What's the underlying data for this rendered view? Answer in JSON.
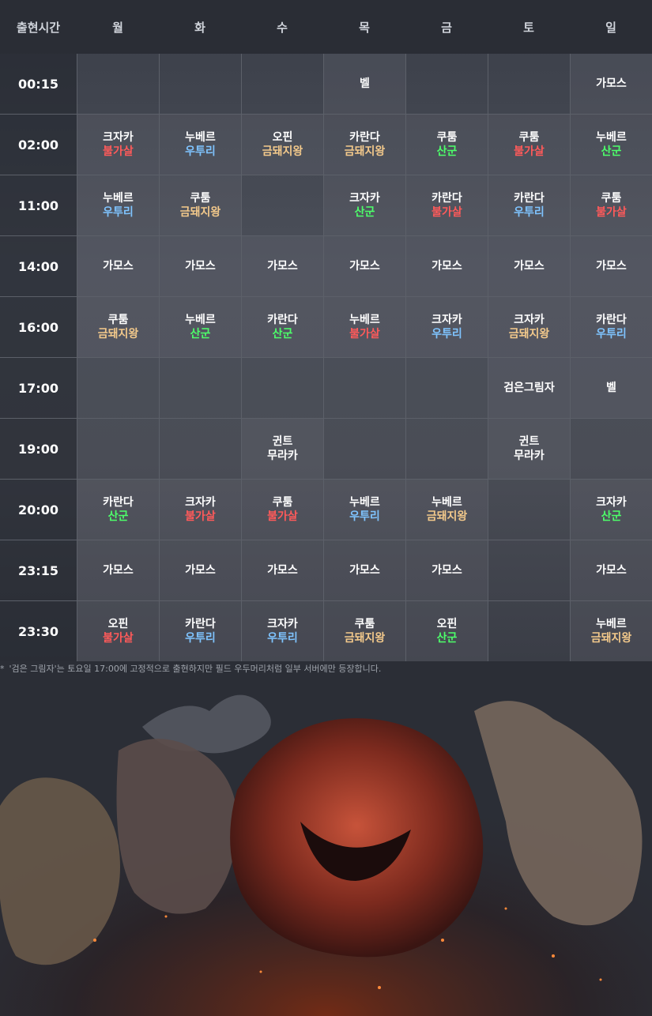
{
  "header": {
    "time_label": "출현시간",
    "days": [
      "월",
      "화",
      "수",
      "목",
      "금",
      "토",
      "일"
    ]
  },
  "colors": {
    "불가살": "#ff5a5a",
    "우투리": "#7fc4ff",
    "금돼지왕": "#f3c98b",
    "산군": "#4dff6a",
    "무라카": "#ffffff"
  },
  "rows": [
    {
      "time": "00:15",
      "cells": [
        {
          "boss": "",
          "tag": ""
        },
        {
          "boss": "",
          "tag": ""
        },
        {
          "boss": "",
          "tag": ""
        },
        {
          "boss": "벨",
          "tag": ""
        },
        {
          "boss": "",
          "tag": ""
        },
        {
          "boss": "",
          "tag": ""
        },
        {
          "boss": "가모스",
          "tag": ""
        }
      ]
    },
    {
      "time": "02:00",
      "cells": [
        {
          "boss": "크자카",
          "tag": "불가살"
        },
        {
          "boss": "누베르",
          "tag": "우투리"
        },
        {
          "boss": "오핀",
          "tag": "금돼지왕"
        },
        {
          "boss": "카란다",
          "tag": "금돼지왕"
        },
        {
          "boss": "쿠툼",
          "tag": "산군"
        },
        {
          "boss": "쿠툼",
          "tag": "불가살"
        },
        {
          "boss": "누베르",
          "tag": "산군"
        }
      ]
    },
    {
      "time": "11:00",
      "cells": [
        {
          "boss": "누베르",
          "tag": "우투리"
        },
        {
          "boss": "쿠툼",
          "tag": "금돼지왕"
        },
        {
          "boss": "",
          "tag": ""
        },
        {
          "boss": "크자카",
          "tag": "산군"
        },
        {
          "boss": "카란다",
          "tag": "불가살"
        },
        {
          "boss": "카란다",
          "tag": "우투리"
        },
        {
          "boss": "쿠툼",
          "tag": "불가살"
        }
      ]
    },
    {
      "time": "14:00",
      "cells": [
        {
          "boss": "가모스",
          "tag": ""
        },
        {
          "boss": "가모스",
          "tag": ""
        },
        {
          "boss": "가모스",
          "tag": ""
        },
        {
          "boss": "가모스",
          "tag": ""
        },
        {
          "boss": "가모스",
          "tag": ""
        },
        {
          "boss": "가모스",
          "tag": ""
        },
        {
          "boss": "가모스",
          "tag": ""
        }
      ]
    },
    {
      "time": "16:00",
      "cells": [
        {
          "boss": "쿠툼",
          "tag": "금돼지왕"
        },
        {
          "boss": "누베르",
          "tag": "산군"
        },
        {
          "boss": "카란다",
          "tag": "산군"
        },
        {
          "boss": "누베르",
          "tag": "불가살"
        },
        {
          "boss": "크자카",
          "tag": "우투리"
        },
        {
          "boss": "크자카",
          "tag": "금돼지왕"
        },
        {
          "boss": "카란다",
          "tag": "우투리"
        }
      ]
    },
    {
      "time": "17:00",
      "cells": [
        {
          "boss": "",
          "tag": ""
        },
        {
          "boss": "",
          "tag": ""
        },
        {
          "boss": "",
          "tag": ""
        },
        {
          "boss": "",
          "tag": ""
        },
        {
          "boss": "",
          "tag": ""
        },
        {
          "boss": "검은그림자",
          "tag": ""
        },
        {
          "boss": "벨",
          "tag": ""
        }
      ]
    },
    {
      "time": "19:00",
      "cells": [
        {
          "boss": "",
          "tag": ""
        },
        {
          "boss": "",
          "tag": ""
        },
        {
          "boss": "귄트",
          "tag": "무라카"
        },
        {
          "boss": "",
          "tag": ""
        },
        {
          "boss": "",
          "tag": ""
        },
        {
          "boss": "귄트",
          "tag": "무라카"
        },
        {
          "boss": "",
          "tag": ""
        }
      ]
    },
    {
      "time": "20:00",
      "cells": [
        {
          "boss": "카란다",
          "tag": "산군"
        },
        {
          "boss": "크자카",
          "tag": "불가살"
        },
        {
          "boss": "쿠툼",
          "tag": "불가살"
        },
        {
          "boss": "누베르",
          "tag": "우투리"
        },
        {
          "boss": "누베르",
          "tag": "금돼지왕"
        },
        {
          "boss": "",
          "tag": ""
        },
        {
          "boss": "크자카",
          "tag": "산군"
        }
      ]
    },
    {
      "time": "23:15",
      "cells": [
        {
          "boss": "가모스",
          "tag": ""
        },
        {
          "boss": "가모스",
          "tag": ""
        },
        {
          "boss": "가모스",
          "tag": ""
        },
        {
          "boss": "가모스",
          "tag": ""
        },
        {
          "boss": "가모스",
          "tag": ""
        },
        {
          "boss": "",
          "tag": ""
        },
        {
          "boss": "가모스",
          "tag": ""
        }
      ]
    },
    {
      "time": "23:30",
      "cells": [
        {
          "boss": "오핀",
          "tag": "불가살"
        },
        {
          "boss": "카란다",
          "tag": "우투리"
        },
        {
          "boss": "크자카",
          "tag": "우투리"
        },
        {
          "boss": "쿠툼",
          "tag": "금돼지왕"
        },
        {
          "boss": "오핀",
          "tag": "산군"
        },
        {
          "boss": "",
          "tag": ""
        },
        {
          "boss": "누베르",
          "tag": "금돼지왕"
        }
      ]
    }
  ],
  "note": {
    "star": "*",
    "text": "'검은 그림자'는 토요일 17:00에 고정적으로 출현하지만 필드 우두머리처럼 일부 서버에만 등장합니다."
  },
  "artwork": "boss-monsters-illustration"
}
